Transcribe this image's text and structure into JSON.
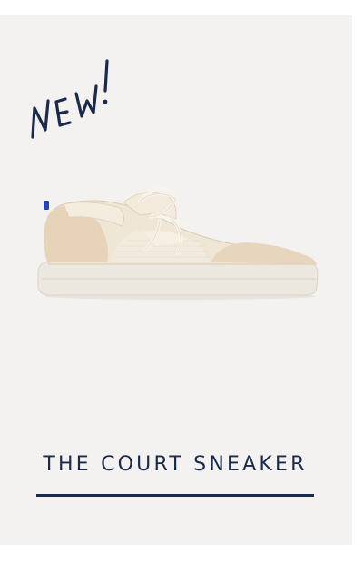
{
  "badge": {
    "text": "NEW!"
  },
  "product": {
    "title": "THE COURT SNEAKER",
    "image_name": "court-sneaker-photo"
  },
  "colors": {
    "card_background": "#f3f2f0",
    "title_navy": "#1c2a4a",
    "badge_ink": "#1c2a4a"
  }
}
